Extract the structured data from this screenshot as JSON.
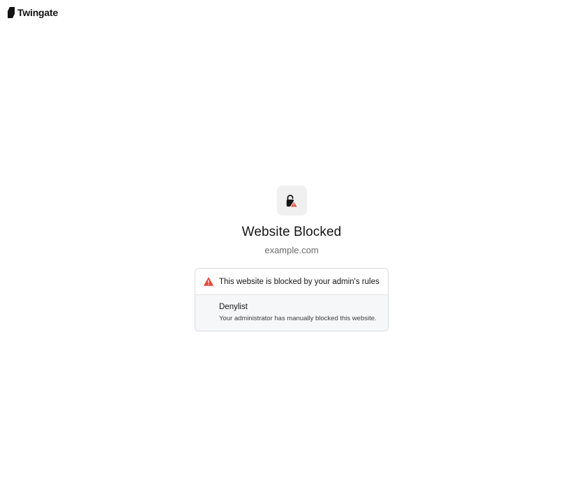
{
  "brand": {
    "name": "Twingate",
    "logo_icon": "twingate-logo-icon"
  },
  "status": {
    "icon": "lock-warning-icon",
    "title": "Website Blocked",
    "domain": "example.com"
  },
  "block_card": {
    "icon": "warning-triangle-icon",
    "message": "This website is blocked by your admin's rules",
    "rule_name": "Denylist",
    "rule_description": "Your administrator has manually blocked this website."
  },
  "colors": {
    "warning": "#e5483c",
    "lock": "#151515",
    "tile_background": "#f0f0f1"
  }
}
